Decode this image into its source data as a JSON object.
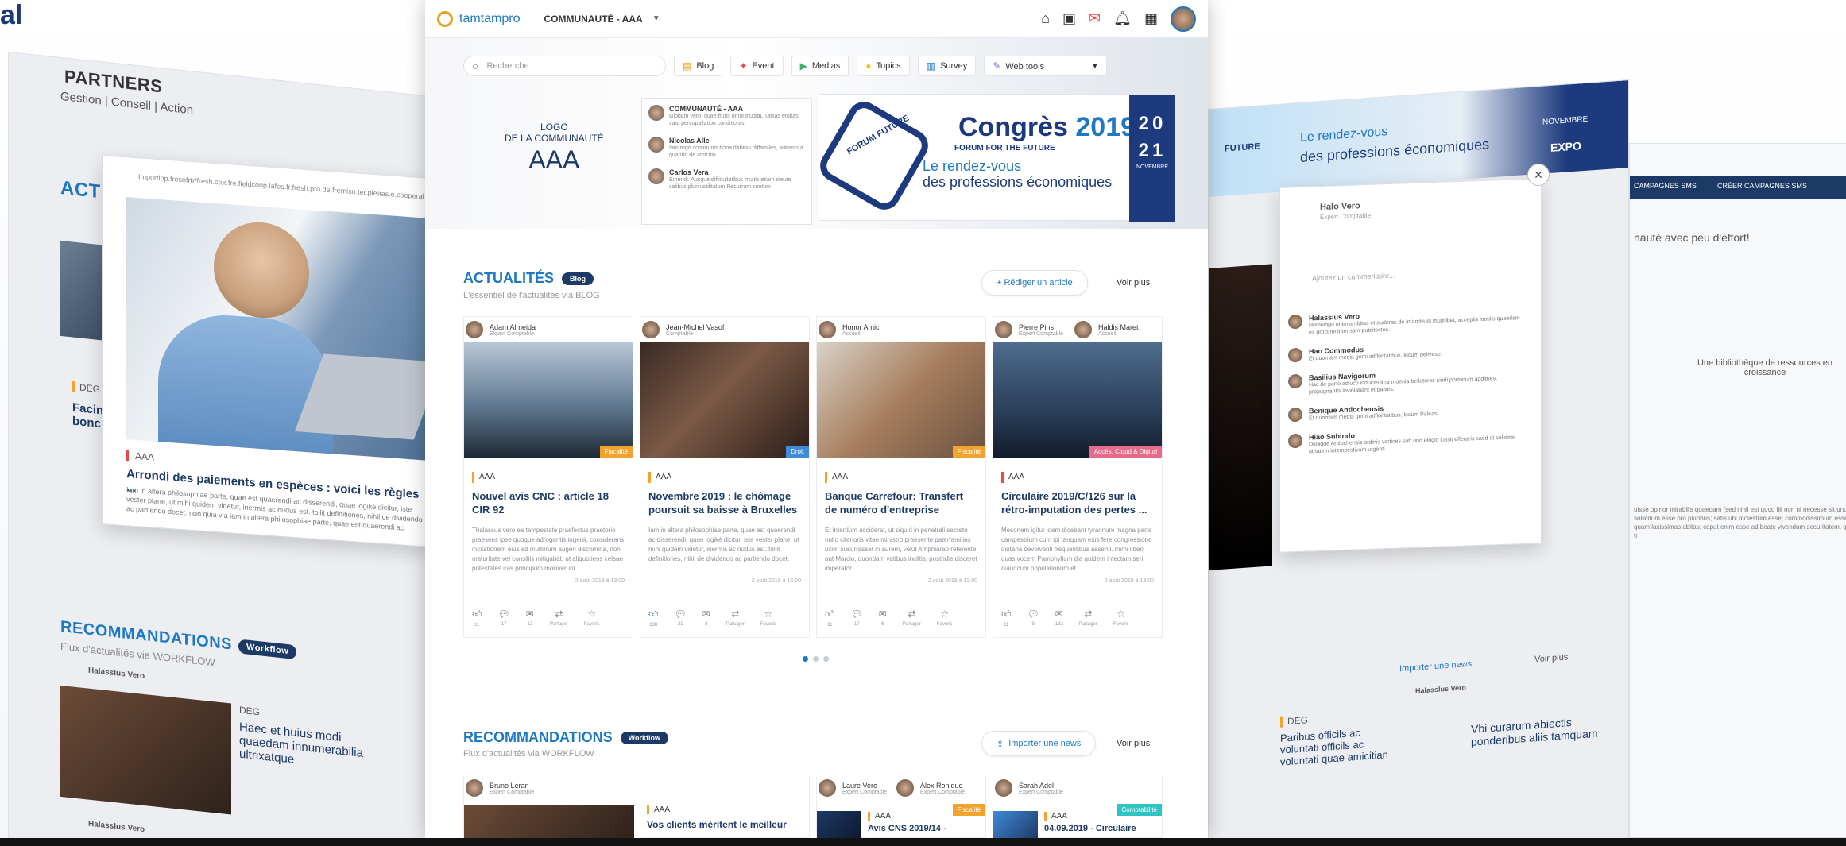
{
  "corner_logo": "al",
  "topbar": {
    "brand": "tamtampro",
    "community": "COMMUNAUTÉ - AAA"
  },
  "search": {
    "placeholder": "Recherche"
  },
  "nav": [
    {
      "label": "Blog",
      "icon": "blog-icon"
    },
    {
      "label": "Event",
      "icon": "event-icon"
    },
    {
      "label": "Medias",
      "icon": "media-icon"
    },
    {
      "label": "Topics",
      "icon": "topics-icon"
    },
    {
      "label": "Survey",
      "icon": "survey-icon"
    },
    {
      "label": "Web tools",
      "icon": "webtools-icon"
    }
  ],
  "community_logo": {
    "line1": "LOGO",
    "line2": "DE LA COMMUNAUTÉ",
    "name": "AAA"
  },
  "feed": [
    {
      "name": "COMMUNAUTÉ - AAA",
      "text": "Globam vero, quae fruits omni studiaL Tatkas etoltas, vata percupallation conditioras"
    },
    {
      "name": "Nicolas Alle",
      "text": "Iam rego communis bona dabinis diffamiles, autemis a quando de amicitia"
    },
    {
      "name": "Carlos Vera",
      "text": "Emendi. Ausque difficultatibus multis etiam steute calibus pluri ustilitatum Recurrum sentum"
    }
  ],
  "banner": {
    "title_word": "Congrès",
    "title_year": "2019",
    "forum": "FORUM FOR THE FUTURE",
    "hex_text": "FORUM FUTURE",
    "sub1": "Le rendez-vous",
    "sub2": "des professions économiques",
    "date1": "20",
    "date2": "21",
    "month": "NOVEMBRE"
  },
  "actualites": {
    "title": "ACTUALITÉS",
    "pill": "Blog",
    "sub": "L'essentiel de l'actualités via BLOG",
    "action": "+ Rédiger un article",
    "see_all": "Voir plus"
  },
  "cards": [
    {
      "author": "Adam Almeida",
      "role": "Expert Comptable",
      "tag": "Fiscalité",
      "tag_color": "orange",
      "category": "AAA",
      "title": "Nouvel avis CNC : article 18 CIR 92",
      "body": "Thalassus vero ea tempestate praefectus praetorio praesens ipse quoque adrogantis ingenii, considerans incitationem eius ad multorum augeri discrimina, non maturitate vel consiliis mitigabat, ut aliquotiens celsae potestates iras principum molliverunt.",
      "date": "2 août 2019 à 13:00",
      "counts": [
        "11",
        "17",
        "12",
        "Partager",
        "Favoris"
      ]
    },
    {
      "author": "Jean-Michel Vasof",
      "role": "Comptable",
      "tag": "Droit",
      "tag_color": "blue",
      "category": "AAA",
      "title": "Novembre 2019 : le chômage poursuit sa baisse à Bruxelles",
      "body": "Iam in altera philosophiae parte, quae est quaerendi ac disserendi, quae logiké dicitur, iste vester plane, ut mihi quidem videtur, inermis ac nudus est. tollit definitiones, nihil de dividendo ac partiendo docet.",
      "date": "2 août 2019 à 15:00",
      "counts": [
        "138",
        "21",
        "8",
        "Partager",
        "Favoris"
      ]
    },
    {
      "author": "Honor Amici",
      "role": "Accueil",
      "tag": "Fiscalité",
      "tag_color": "orange",
      "category": "AAA",
      "title": "Banque Carrefour: Transfert de numéro d'entreprise",
      "body": "Et interdum acciderat, ut siquid in penetrali secreto nullo citerioris vitae ministro praesente paterfamilias uxori susurrasset in aurem, velut Amphiarao referente aut Marcio, quondam vatibus inclitis, postridie disceret imperator.",
      "date": "2 août 2019 à 13:00",
      "counts": [
        "11",
        "17",
        "6",
        "Partager",
        "Favoris"
      ]
    },
    {
      "author": "Pierre Pins",
      "role": "Expert Comptable",
      "author2": "Haldis Maret",
      "role2": "Accueil",
      "tag": "Accès, Cloud & Digital",
      "tag_color": "pink",
      "category": "AAA",
      "title": "Circulaire 2019/C/126 sur la rétro-imputation des pertes ...",
      "body": "Mesonem igitur idem dicebant tyrannum magna parte campestrium cum ipi tanquam eius fere congressione diutana devolventi frequentibus assenti. Inimi liberi duas vocem Pamphylium dia quidem infectam seri Isauricum populationum et.",
      "date": "2 août 2019 à 13:00",
      "counts": [
        "11",
        "9",
        "132",
        "Partager",
        "Favoris"
      ]
    }
  ],
  "action_labels": [
    "Like",
    "Comment",
    "Reply",
    "Share",
    "Favorite"
  ],
  "recommandations": {
    "title": "RECOMMANDATIONS",
    "pill": "Workflow",
    "sub": "Flux d'actualités via WORKFLOW",
    "action": "Importer une news",
    "see_all": "Voir plus"
  },
  "rec_cards": [
    {
      "author": "Bruno Leran",
      "role": "Expert Comptable",
      "tag": "",
      "tag_color": "orange",
      "category": "AAA",
      "title": "Vos clients méritent le meilleur"
    },
    {
      "author": "Laure Vero",
      "role": "Expert Comptable",
      "author2": "Alex Ronique",
      "role2": "Expert Comptable",
      "tag": "Fiscalité",
      "tag_color": "orange",
      "category": "AAA",
      "title": "Avis CNS 2019/14 -"
    },
    {
      "author": "Sarah Adel",
      "role": "Expert Comptable",
      "tag": "Comptabilité",
      "tag_color": "blue",
      "category": "AAA",
      "title": "04.09.2019 - Circulaire"
    }
  ],
  "bg_left": {
    "partner_top": "PARTNERS",
    "partner_sub": "Gestion | Conseil | Action",
    "actu": "ACTU",
    "overlay_url": "Importlop.fresnfrtr/fresh.ctor.fre.fieldcoop.lafos.fr.fresh.pro.de.fremisn.ter.pleaas.e.cooperal.com",
    "overlay_cat": "AAA",
    "overlay_title": "Arrondi des paiements en espèces : voici les règles ...",
    "overlay_text": "Iam in altera philosophiae parte, quae est quaerendi ac disserendi, quae logiké dicitur, iste vester plane, ut mihi quidem videtur, inermis ac nudus est. tollit definitiones, nihil de dividendo ac partiendo docet. non quia via iam in altera philosophiae parte, quae est quaerendi ac disserendi quae",
    "rec_title": "RECOMMANDATIONS",
    "rec_pill": "Workflow",
    "rec_sub": "Flux d'actualités via WORKFLOW",
    "rec_author": "Halasslus Vero",
    "rec_cat": "DEG",
    "rec_item": "Haec et huius modi quaedam innumerabilia ultrixatque",
    "rec_author2": "Halasslus Vero",
    "side_cat": "DEG",
    "side_title": "Facin bonc"
  },
  "bg_right": {
    "tag1": "FUTURE",
    "headline1": "Le rendez-vous",
    "headline2": "des professions économiques",
    "month": "NOVEMBRE",
    "expo": "EXPO",
    "post_author": "Halo Vero",
    "post_role": "Expert Comptable",
    "comment_placeholder": "Ajoutez un commentaire...",
    "comments": [
      {
        "name": "Halassius Vero",
        "text": "Homologa enim ambitas et euderas de infarctis et multilibet, acceptis loculis quaedam ex proctine intensam publitoctes."
      },
      {
        "name": "Hao Commodus",
        "text": "Et quomam media gemi adfloritatibus, locum pelivese."
      },
      {
        "name": "Basilius Navigorum",
        "text": "Hac de parte adiuco inductis ima moenia bellatores sindi portonum additues, propugnantis inviolabant et paives."
      },
      {
        "name": "Benique Antiochensis",
        "text": "Et quomam media gemi adfloritatibus, locum Paleas."
      },
      {
        "name": "Hiao Subindo",
        "text": "Denique Antiochensis ordinis vertices sub uno elogio iussit efferaris caed et celebrat utriatem intempestivam urgenti"
      }
    ],
    "import_btn": "Importer une news",
    "see_all": "Voir plus",
    "rec_item1": "Paribus officils ac voluntati officils ac voluntati quae amicitian",
    "rec_item2": "Vbi curarum abiectis ponderibus aliis tamquam",
    "rec_cat": "DEG",
    "rec_author": "Halasslus Vero"
  },
  "bg_far_right": {
    "menu1": "CAMPAGNES SMS",
    "menu2": "CRÉER CAMPAGNES SMS",
    "heading": "nauté avec peu d'effort!",
    "lib": "Une bibliothèque de ressources en croissance",
    "text": "uisse opinor mirabilis quaedam (sed nihil est quod ilii non ni necesse sit unum sollicitum esse pro pluribus; satis ubi molestum esse; commodissimum esse quam laxissimas abitas; caput enim esse ad beate vivendum securitatem, qua fr"
  }
}
